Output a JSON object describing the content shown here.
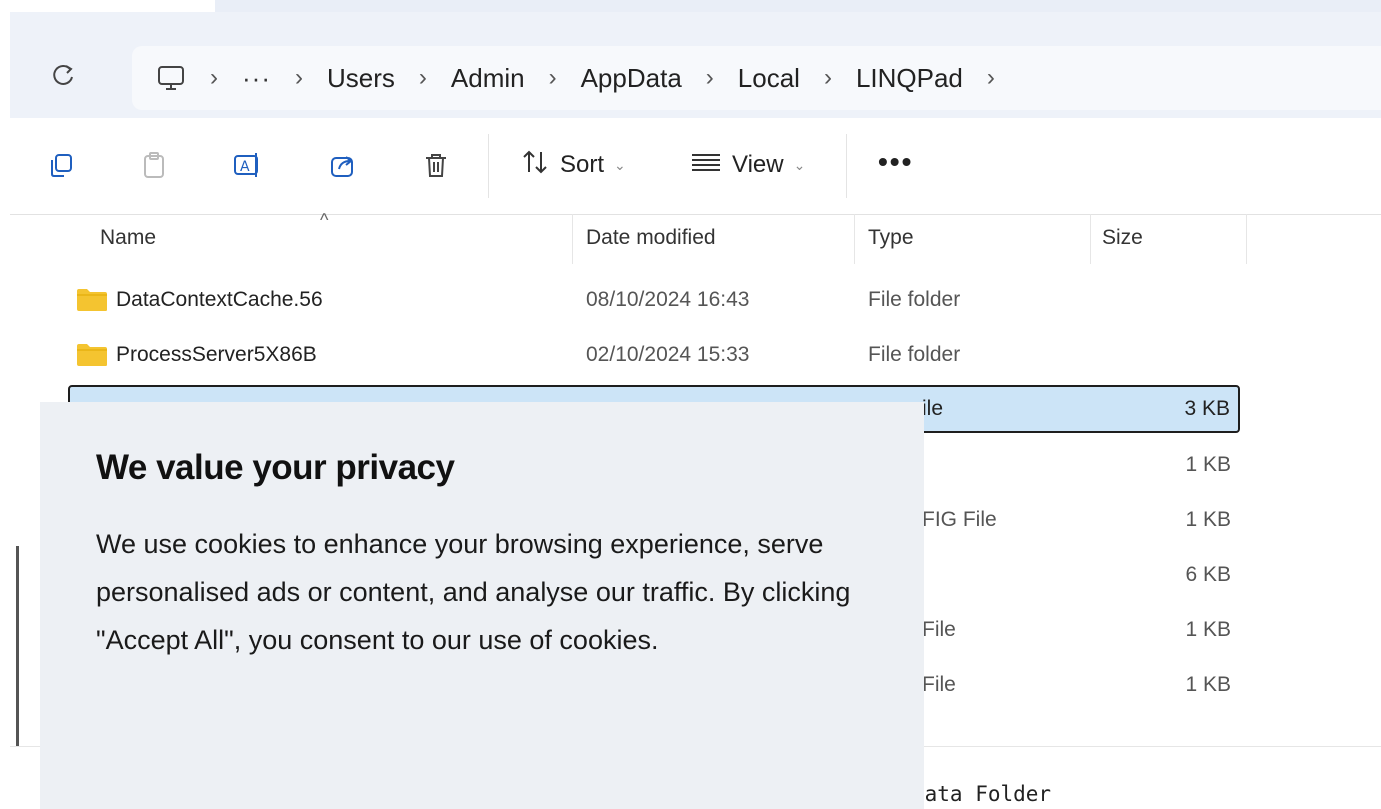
{
  "breadcrumb": {
    "items": [
      "Users",
      "Admin",
      "AppData",
      "Local",
      "LINQPad"
    ],
    "separator": "›",
    "overflow": "···"
  },
  "toolbar": {
    "sort_label": "Sort",
    "view_label": "View",
    "more_label": "•••"
  },
  "columns": {
    "name": "Name",
    "date": "Date modified",
    "type": "Type",
    "size": "Size"
  },
  "rows": [
    {
      "name": "DataContextCache.56",
      "date": "08/10/2024 16:43",
      "type": "File folder",
      "size": ""
    },
    {
      "name": "ProcessServer5X86B",
      "date": "02/10/2024 15:33",
      "type": "File folder",
      "size": ""
    },
    {
      "name": "",
      "date": "",
      "type": "File",
      "size": "3 KB",
      "partial_type": "ile"
    }
  ],
  "obscured_rows": {
    "sizes": [
      "1 KB",
      "1 KB",
      "6 KB",
      "1 KB",
      "1 KB"
    ],
    "types": [
      "",
      "FIG File",
      "",
      "File",
      "File"
    ]
  },
  "caption": ")ata Folder",
  "cookie": {
    "title": "We value your privacy",
    "body": "We use cookies to enhance your browsing experience, serve personalised ads or content, and analyse our traffic. By clicking \"Accept All\", you consent to our use of cookies."
  },
  "colors": {
    "folder": "#f4c430",
    "selection": "#cce4f7",
    "banner": "#edf0f4"
  }
}
